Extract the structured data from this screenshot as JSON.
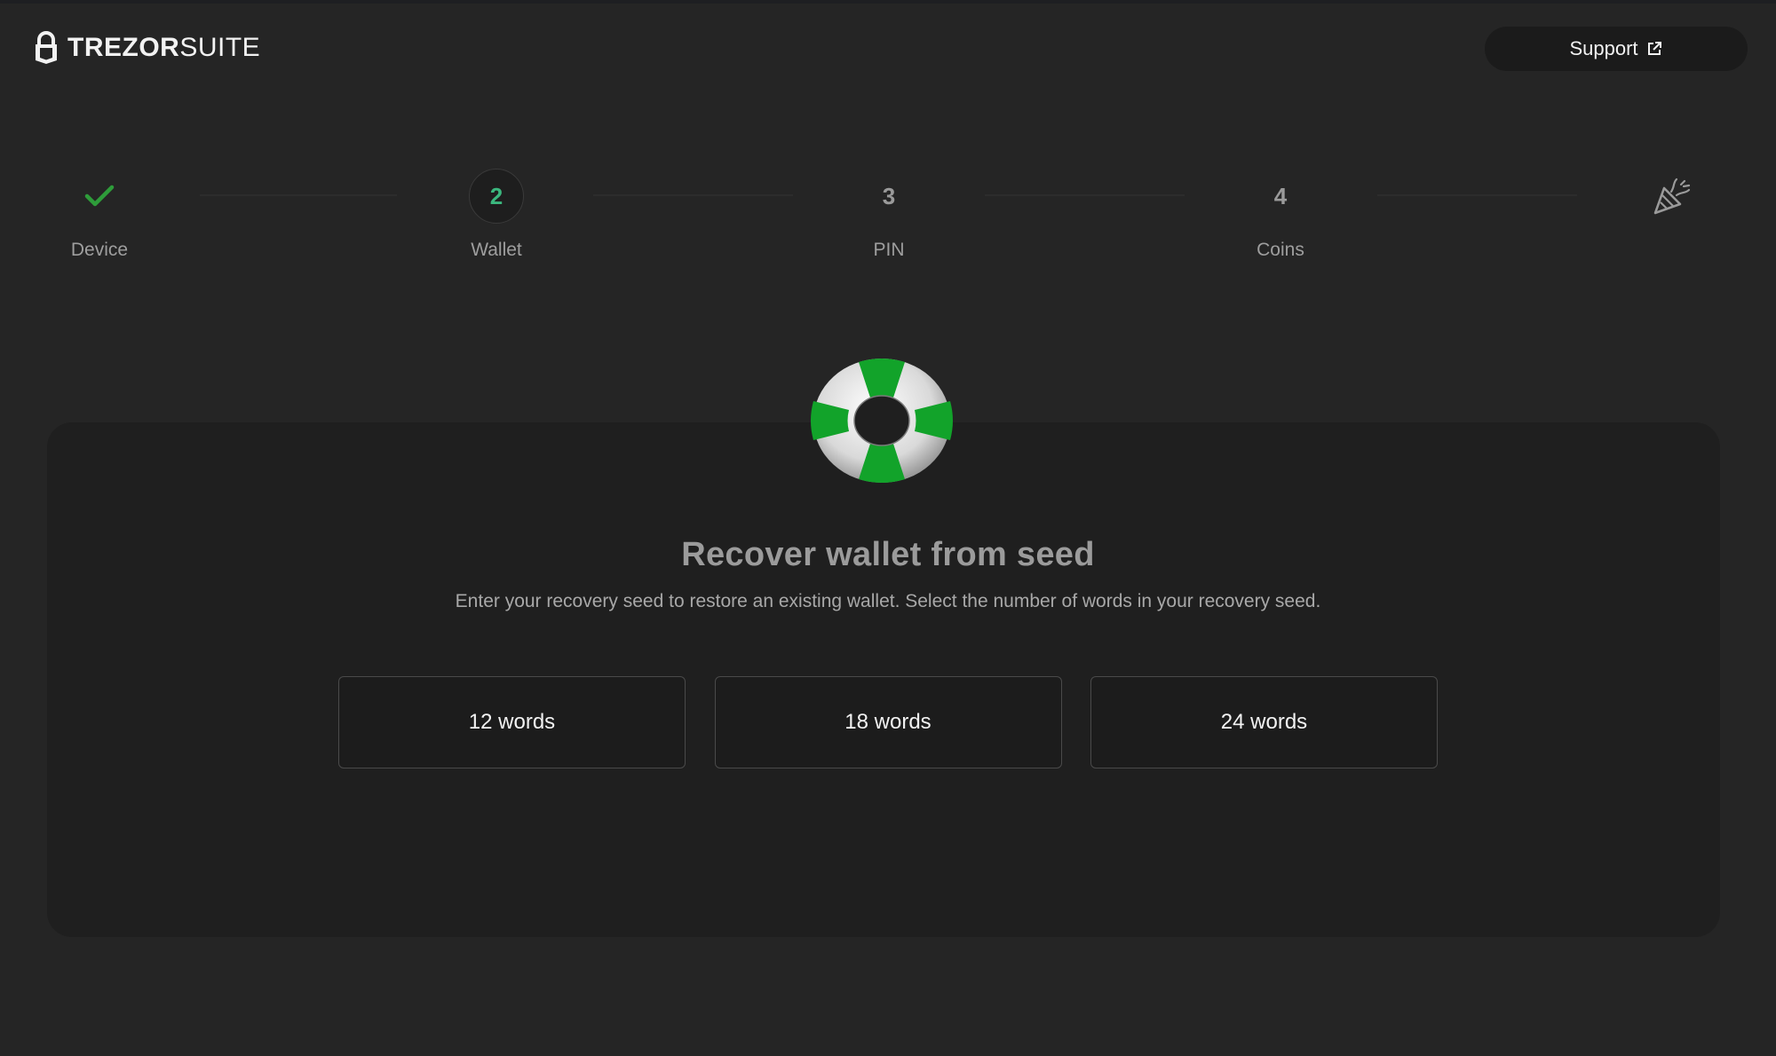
{
  "header": {
    "logo": {
      "text_bold": "TREZOR",
      "text_light": "SUITE"
    },
    "support_label": "Support"
  },
  "stepper": {
    "steps": [
      {
        "label": "Device",
        "mark": "",
        "state": "done",
        "icon": "check-icon"
      },
      {
        "label": "Wallet",
        "mark": "2",
        "state": "active"
      },
      {
        "label": "PIN",
        "mark": "3",
        "state": "upcoming"
      },
      {
        "label": "Coins",
        "mark": "4",
        "state": "upcoming"
      }
    ],
    "final_icon": "party-popper-icon"
  },
  "recovery": {
    "icon": "lifebuoy-icon",
    "title": "Recover wallet from seed",
    "subtitle": "Enter your recovery seed to restore an existing wallet. Select the number of words in your recovery seed.",
    "options": [
      "12 words",
      "18 words",
      "24 words"
    ]
  },
  "colors": {
    "background": "#252525",
    "card": "#1f1f1f",
    "accent_green": "#3bb77e",
    "check_green": "#2e9c3a",
    "lifebuoy_green": "#12a32a"
  }
}
